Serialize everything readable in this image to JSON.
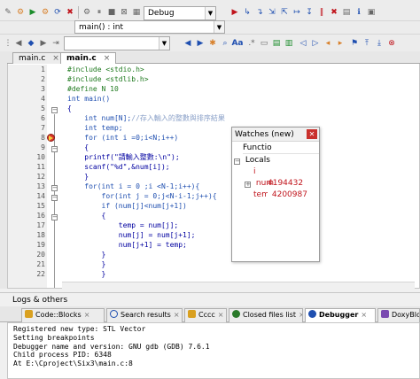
{
  "toolbar": {
    "build_target_combo": "Debug",
    "function_combo": "main() : int",
    "scope_combo": ""
  },
  "editor": {
    "tabs": [
      {
        "label": "main.c",
        "active": false
      },
      {
        "label": "main.c",
        "active": true
      }
    ],
    "lines": [
      {
        "n": "1",
        "code": "#include <stdio.h>"
      },
      {
        "n": "2",
        "code": "#include <stdlib.h>"
      },
      {
        "n": "3",
        "code": "#define N 10"
      },
      {
        "n": "4",
        "code": "int main()"
      },
      {
        "n": "5",
        "code": "{"
      },
      {
        "n": "6",
        "code": "    int num[N];//存入輸入的整數與排序結果"
      },
      {
        "n": "7",
        "code": "    int temp;"
      },
      {
        "n": "8",
        "code": "    for (int i =0;i<N;i++)"
      },
      {
        "n": "9",
        "code": "    {"
      },
      {
        "n": "10",
        "code": "    printf(\"請輸入整數:\\n\");"
      },
      {
        "n": "11",
        "code": "    scanf(\"%d\",&num[i]);"
      },
      {
        "n": "12",
        "code": "    }"
      },
      {
        "n": "13",
        "code": "    for(int i = 0 ;i <N-1;i++){"
      },
      {
        "n": "14",
        "code": "        for(int j = 0;j<N-i-1;j++){"
      },
      {
        "n": "15",
        "code": "        if (num[j]<num[j+1])"
      },
      {
        "n": "16",
        "code": "        {"
      },
      {
        "n": "17",
        "code": "            temp = num[j];"
      },
      {
        "n": "18",
        "code": "            num[j] = num[j+1];"
      },
      {
        "n": "19",
        "code": "            num[j+1] = temp;"
      },
      {
        "n": "20",
        "code": "        }"
      },
      {
        "n": "21",
        "code": "        }"
      },
      {
        "n": "22",
        "code": "        }"
      }
    ],
    "breakpoint_line": 8
  },
  "watches": {
    "title": "Watches (new)",
    "col_header": "Functio",
    "locals_label": "Locals",
    "rows": [
      {
        "name": "i",
        "value": "4194432",
        "expandable": false
      },
      {
        "name": "num",
        "value": "",
        "expandable": true
      },
      {
        "name": "temp",
        "value": "4200987",
        "expandable": false
      }
    ]
  },
  "logs": {
    "header": "Logs & others",
    "tabs": [
      {
        "label": "Code::Blocks",
        "active": false
      },
      {
        "label": "Search results",
        "active": false
      },
      {
        "label": "Cccc",
        "active": false
      },
      {
        "label": "Closed files list",
        "active": false
      },
      {
        "label": "Debugger",
        "active": true
      },
      {
        "label": "DoxyBlocks",
        "active": false
      }
    ],
    "lines": [
      "Registered new type: STL Vector",
      "Setting breakpoints",
      "Debugger name and version: GNU gdb (GDB) 7.6.1",
      "Child process PID: 6348",
      "At E:\\Cproject\\Six3\\main.c:8"
    ]
  },
  "colors": {
    "breakpoint": "#d9342b",
    "accent": "#1f4fb0"
  }
}
